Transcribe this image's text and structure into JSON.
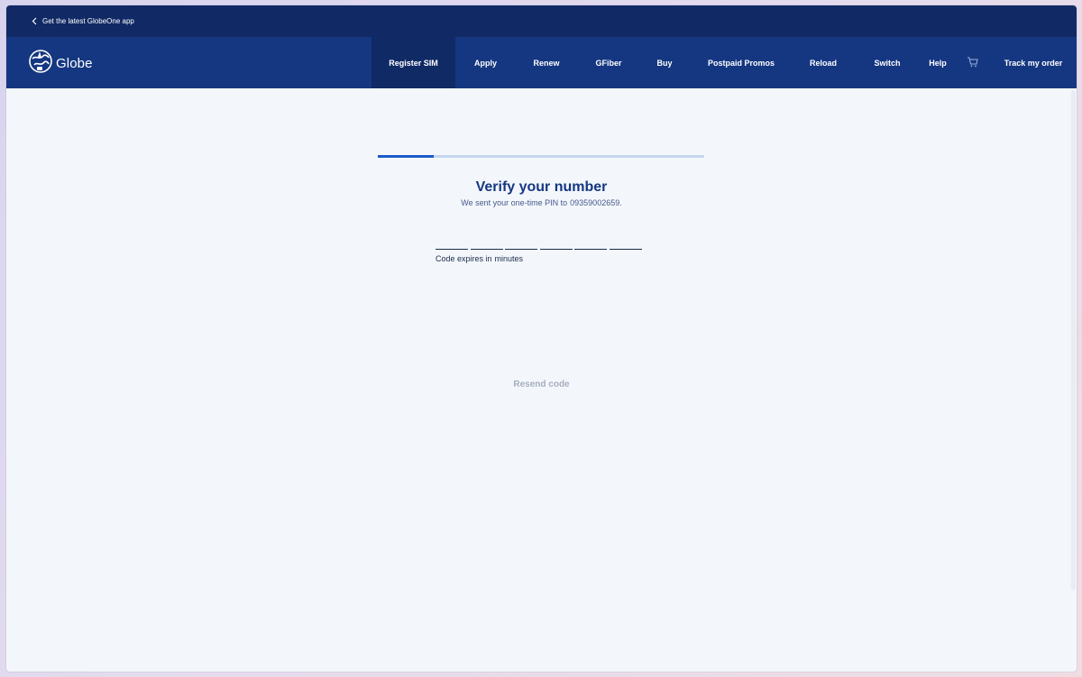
{
  "topbar": {
    "app_link": "Get the latest GlobeOne app"
  },
  "brand": {
    "name": "Globe"
  },
  "nav": {
    "items": [
      {
        "label": "Register SIM"
      },
      {
        "label": "Apply"
      },
      {
        "label": "Renew"
      },
      {
        "label": "GFiber"
      },
      {
        "label": "Buy"
      },
      {
        "label": "Postpaid Promos"
      },
      {
        "label": "Reload"
      },
      {
        "label": "Switch"
      },
      {
        "label": "Help"
      }
    ],
    "cart_icon": "cart-icon",
    "track_order": "Track my order"
  },
  "verify": {
    "progress_fraction": 0.17,
    "title": "Verify your number",
    "subtitle": "We sent your one-time PIN to",
    "phone": "09359002659.",
    "pin_placeholder": "",
    "expires_label": "Code expires in",
    "expires_unit": "minutes",
    "resend": "Resend code"
  },
  "colors": {
    "topbar": "#112a65",
    "nav": "#153781",
    "nav_active": "#102a66",
    "accent": "#1b5bc8",
    "title": "#153781",
    "disabled_text": "#a7aebb",
    "background": "#f3f7fc"
  }
}
